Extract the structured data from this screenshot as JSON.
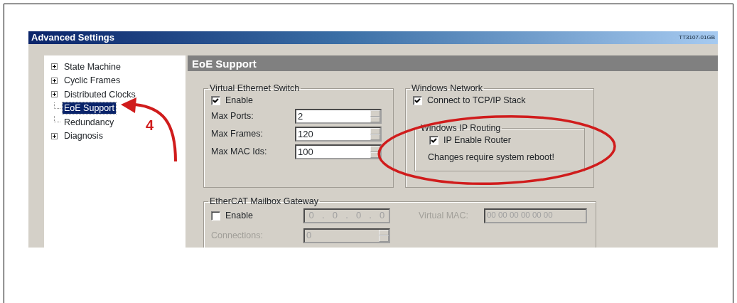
{
  "window": {
    "title": "Advanced Settings",
    "doc_code": "TT3107-01GB"
  },
  "tree": [
    {
      "label": "State Machine",
      "expandable": true,
      "selected": false
    },
    {
      "label": "Cyclic Frames",
      "expandable": true,
      "selected": false
    },
    {
      "label": "Distributed Clocks",
      "expandable": true,
      "selected": false
    },
    {
      "label": "EoE Support",
      "expandable": false,
      "selected": true
    },
    {
      "label": "Redundancy",
      "expandable": false,
      "selected": false
    },
    {
      "label": "Diagnosis",
      "expandable": true,
      "selected": false
    }
  ],
  "panel": {
    "title": "EoE Support"
  },
  "virtual_switch": {
    "title": "Virtual Ethernet Switch",
    "enable": {
      "label": "Enable",
      "checked": true
    },
    "fields": [
      {
        "label": "Max Ports:",
        "value": "2"
      },
      {
        "label": "Max Frames:",
        "value": "120"
      },
      {
        "label": "Max MAC Ids:",
        "value": "100"
      }
    ]
  },
  "windows_network": {
    "title": "Windows Network",
    "connect": {
      "label": "Connect to TCP/IP Stack",
      "checked": true
    },
    "routing": {
      "title": "Windows IP Routing",
      "router": {
        "label": "IP Enable Router",
        "checked": true
      },
      "note": "Changes require system reboot!"
    }
  },
  "gateway": {
    "title": "EtherCAT Mailbox Gateway",
    "disabled": true,
    "enable": {
      "label": "Enable",
      "checked": false
    },
    "ip": [
      "0",
      ".",
      "0",
      ".",
      "0",
      ".",
      "0"
    ],
    "mac_label": "Virtual MAC:",
    "mac": "00 00 00 00 00 00",
    "connections_label": "Connections:",
    "connections": "0"
  },
  "annotation": {
    "step": "4"
  }
}
